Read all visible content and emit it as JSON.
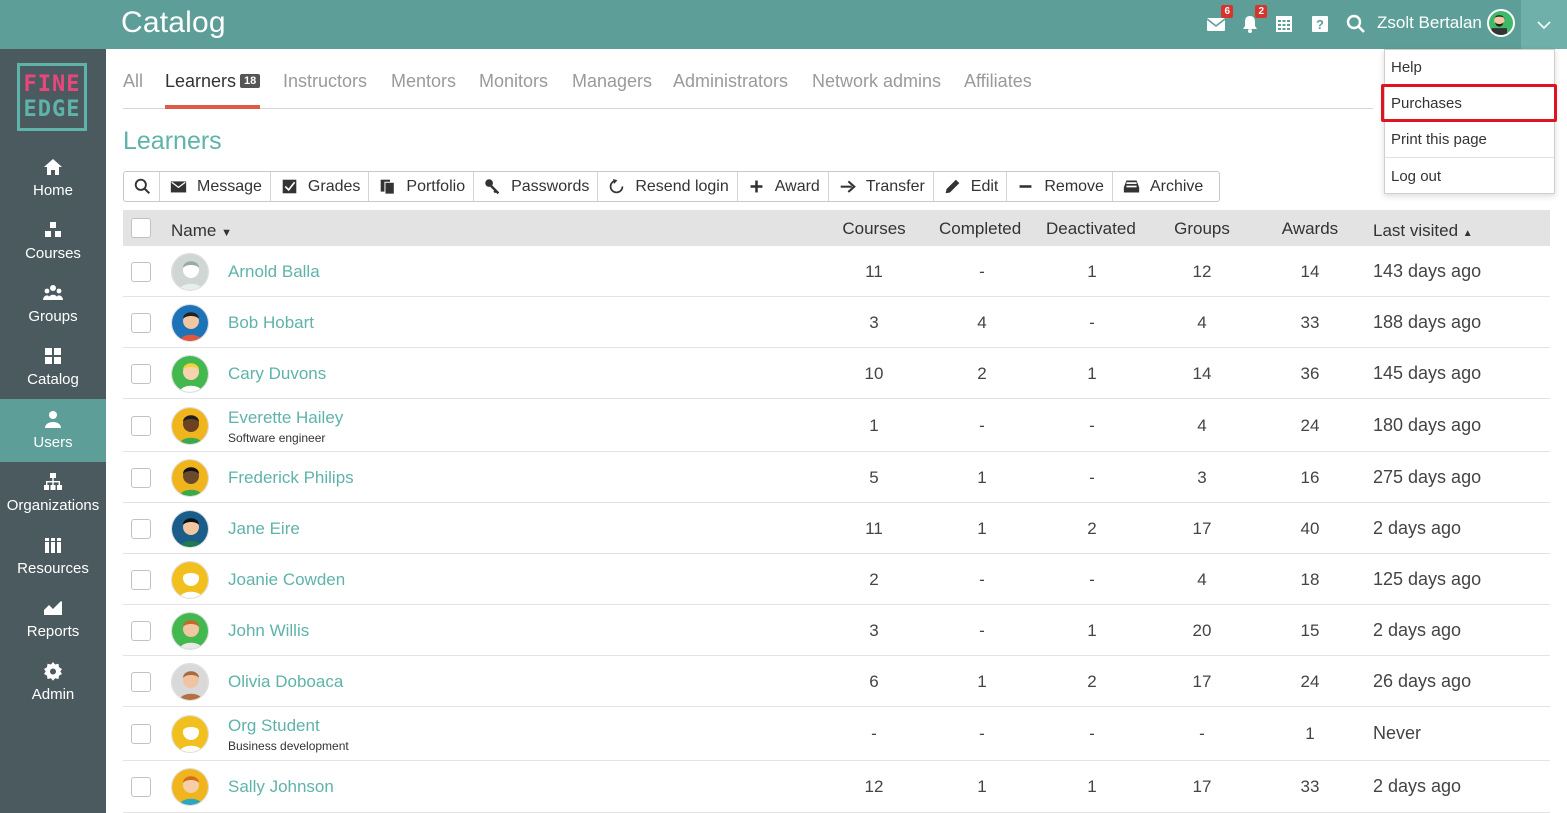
{
  "header": {
    "title": "Catalog",
    "messages_badge": "6",
    "notifications_badge": "2",
    "user_name": "Zsolt Bertalan"
  },
  "logo": {
    "line1": "FINE",
    "line2": "EDGE"
  },
  "sidebar": {
    "items": [
      {
        "label": "Home",
        "icon": "home-icon"
      },
      {
        "label": "Courses",
        "icon": "courses-icon"
      },
      {
        "label": "Groups",
        "icon": "groups-icon"
      },
      {
        "label": "Catalog",
        "icon": "catalog-icon"
      },
      {
        "label": "Users",
        "icon": "users-icon"
      },
      {
        "label": "Organizations",
        "icon": "organizations-icon"
      },
      {
        "label": "Resources",
        "icon": "resources-icon"
      },
      {
        "label": "Reports",
        "icon": "reports-icon"
      },
      {
        "label": "Admin",
        "icon": "gear-icon"
      }
    ],
    "active": "Users"
  },
  "tabs": [
    {
      "label": "All"
    },
    {
      "label": "Learners",
      "count": "18"
    },
    {
      "label": "Instructors"
    },
    {
      "label": "Mentors"
    },
    {
      "label": "Monitors"
    },
    {
      "label": "Managers"
    },
    {
      "label": "Administrators"
    },
    {
      "label": "Network admins"
    },
    {
      "label": "Affiliates"
    }
  ],
  "section_title": "Learners",
  "toolbar": [
    "Message",
    "Grades",
    "Portfolio",
    "Passwords",
    "Resend login",
    "Award",
    "Transfer",
    "Edit",
    "Remove",
    "Archive"
  ],
  "table": {
    "headers": {
      "name": "Name",
      "courses": "Courses",
      "completed": "Completed",
      "deactivated": "Deactivated",
      "groups": "Groups",
      "awards": "Awards",
      "last_visited": "Last visited"
    },
    "rows": [
      {
        "name": "Arnold Balla",
        "subtitle": "",
        "courses": "11",
        "completed": "-",
        "deactivated": "1",
        "groups": "12",
        "awards": "14",
        "last_visited": "143 days ago"
      },
      {
        "name": "Bob Hobart",
        "subtitle": "",
        "courses": "3",
        "completed": "4",
        "deactivated": "-",
        "groups": "4",
        "awards": "33",
        "last_visited": "188 days ago"
      },
      {
        "name": "Cary Duvons",
        "subtitle": "",
        "courses": "10",
        "completed": "2",
        "deactivated": "1",
        "groups": "14",
        "awards": "36",
        "last_visited": "145 days ago"
      },
      {
        "name": "Everette Hailey",
        "subtitle": "Software engineer",
        "courses": "1",
        "completed": "-",
        "deactivated": "-",
        "groups": "4",
        "awards": "24",
        "last_visited": "180 days ago"
      },
      {
        "name": "Frederick Philips",
        "subtitle": "",
        "courses": "5",
        "completed": "1",
        "deactivated": "-",
        "groups": "3",
        "awards": "16",
        "last_visited": "275 days ago"
      },
      {
        "name": "Jane Eire",
        "subtitle": "",
        "courses": "11",
        "completed": "1",
        "deactivated": "2",
        "groups": "17",
        "awards": "40",
        "last_visited": "2 days ago"
      },
      {
        "name": "Joanie Cowden",
        "subtitle": "",
        "courses": "2",
        "completed": "-",
        "deactivated": "-",
        "groups": "4",
        "awards": "18",
        "last_visited": "125 days ago"
      },
      {
        "name": "John Willis",
        "subtitle": "",
        "courses": "3",
        "completed": "-",
        "deactivated": "1",
        "groups": "20",
        "awards": "15",
        "last_visited": "2 days ago"
      },
      {
        "name": "Olivia Doboaca",
        "subtitle": "",
        "courses": "6",
        "completed": "1",
        "deactivated": "2",
        "groups": "17",
        "awards": "24",
        "last_visited": "26 days ago"
      },
      {
        "name": "Org Student",
        "subtitle": "Business development",
        "courses": "-",
        "completed": "-",
        "deactivated": "-",
        "groups": "-",
        "awards": "1",
        "last_visited": "Never"
      },
      {
        "name": "Sally Johnson",
        "subtitle": "",
        "courses": "12",
        "completed": "1",
        "deactivated": "1",
        "groups": "17",
        "awards": "33",
        "last_visited": "2 days ago"
      }
    ]
  },
  "dropdown": {
    "items": [
      "Help",
      "Purchases",
      "Print this page",
      "Log out"
    ],
    "highlighted": "Purchases"
  },
  "colors": {
    "topbar": "#5d9f98",
    "sidebar": "#4b5a5f",
    "accent": "#5eb3aa",
    "tab_underline": "#e05a4a",
    "highlight": "#e0141e"
  }
}
